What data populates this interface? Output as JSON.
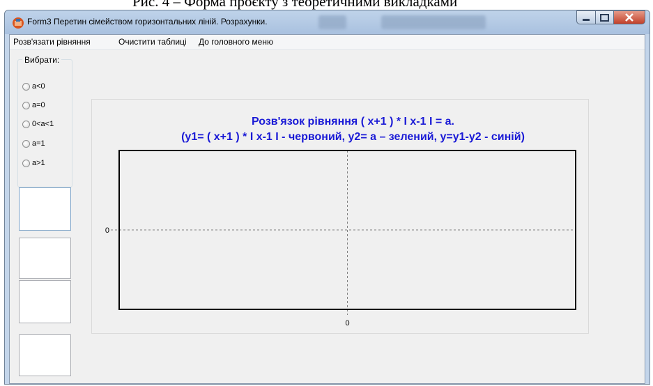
{
  "document": {
    "caption": "Рис. 4 – Форма проєкту з теоретичними викладками"
  },
  "window": {
    "title": "Form3 Перетин сімейством горизонтальних ліній. Розрахунки.",
    "buttons": [
      "minimize",
      "maximize",
      "close"
    ]
  },
  "menu": [
    "Розв'язати рівняння",
    "Очистити таблиці",
    "До головного меню"
  ],
  "group": {
    "label": "Вибрати:",
    "options": [
      "a<0",
      "a=0",
      "0<a<1",
      "a=1",
      "a>1"
    ],
    "selected": null
  },
  "result_boxes": [
    "",
    "",
    "",
    ""
  ],
  "chart_data": {
    "type": "line",
    "title": "Розв'язок рівняння ( x+1 ) * I x-1 I = a.",
    "subtitle": "(y1= ( x+1 ) * I x-1 I - червоний, y2= a – зелений,  y=y1-y2 - синій)",
    "x_tick_labels": [
      "0"
    ],
    "y_tick_labels": [
      "0"
    ],
    "series": [],
    "grid": "dashed lines at x=0 and y=0",
    "colors": {
      "title": "#1a1ad6",
      "axes": "#000000",
      "zero_lines": "#808080"
    }
  }
}
